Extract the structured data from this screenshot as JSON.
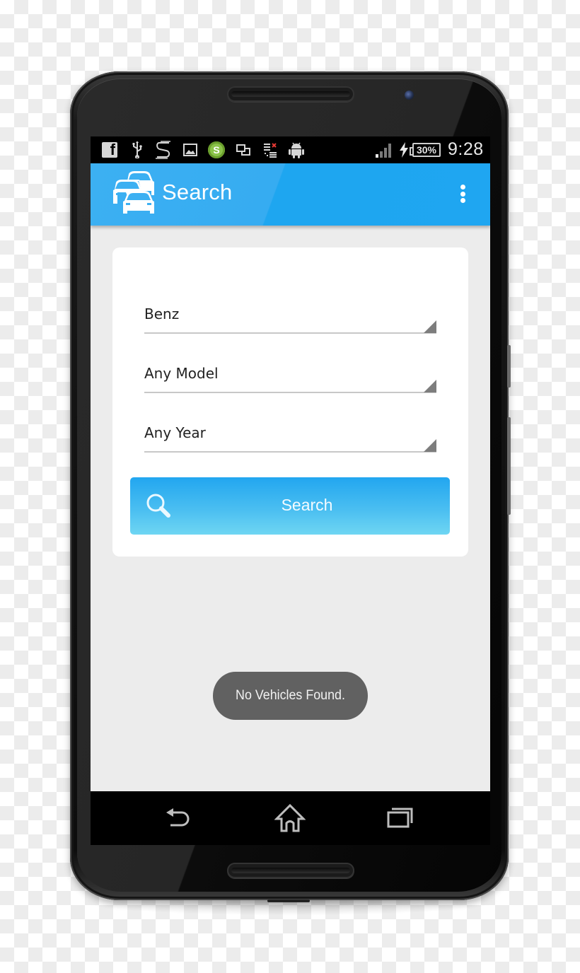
{
  "status_bar": {
    "notification_icons": [
      "facebook-icon",
      "usb-icon",
      "s-app-icon",
      "image-icon",
      "shop-app-icon",
      "windows-icon",
      "download-list-icon",
      "android-icon"
    ],
    "shop_icon_letter": "S",
    "facebook_letter": "f",
    "battery_percent": "30%",
    "charging": true,
    "time": "9:28"
  },
  "app_bar": {
    "title": "Search",
    "logo": "cars-icon",
    "overflow": "more-vertical-icon"
  },
  "form": {
    "make": "Benz",
    "model": "Any Model",
    "year": "Any Year",
    "search_button_label": "Search"
  },
  "toast": {
    "message": "No Vehicles Found."
  },
  "nav_bar": {
    "buttons": [
      "back",
      "home",
      "recent-apps"
    ]
  },
  "colors": {
    "primary": "#1fa6f1",
    "button_gradient_top": "#22a6f0",
    "button_gradient_bottom": "#6fd6f3",
    "toast_bg": "#616161",
    "content_bg": "#ececec"
  }
}
